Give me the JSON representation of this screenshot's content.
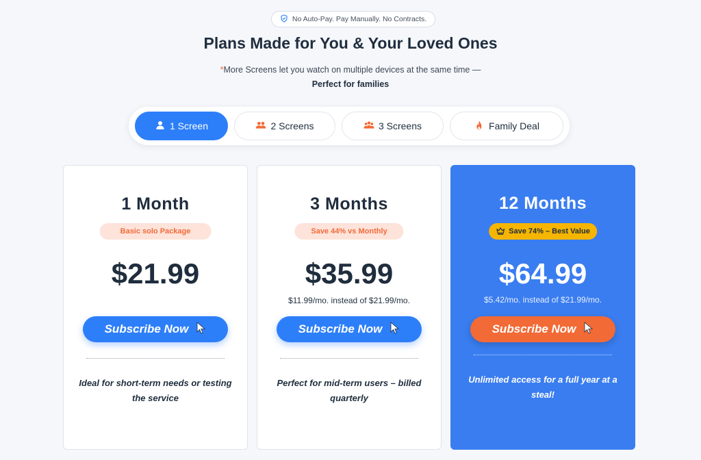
{
  "banner": {
    "text": "No Auto-Pay. Pay Manually. No Contracts.",
    "icon": "shield-check-icon"
  },
  "heading": "Plans Made for You & Your Loved Ones",
  "subtext": {
    "asterisk": "*",
    "line": "More Screens let you watch on multiple devices at the same time — ",
    "bold": "Perfect for families"
  },
  "tabs": [
    {
      "label": "1 Screen",
      "icon": "user-icon",
      "active": true
    },
    {
      "label": "2 Screens",
      "icon": "users-icon",
      "active": false
    },
    {
      "label": "3 Screens",
      "icon": "group-icon",
      "active": false
    },
    {
      "label": "Family Deal",
      "icon": "fire-icon",
      "active": false
    }
  ],
  "plans": [
    {
      "duration": "1 Month",
      "tag": "Basic solo Package",
      "price": "$21.99",
      "per_month": "",
      "cta": "Subscribe Now",
      "description": "Ideal for short-term needs or testing the service",
      "featured": false
    },
    {
      "duration": "3 Months",
      "tag": "Save 44% vs Monthly",
      "price": "$35.99",
      "per_month": "$11.99/mo. instead of $21.99/mo.",
      "cta": "Subscribe Now",
      "description": "Perfect for mid-term users – billed quarterly",
      "featured": false
    },
    {
      "duration": "12 Months",
      "tag": "Save 74% – Best Value",
      "price": "$64.99",
      "per_month": "$5.42/mo. instead of $21.99/mo.",
      "cta": "Subscribe Now",
      "description": "Unlimited access for a full year at a steal!",
      "featured": true
    }
  ],
  "colors": {
    "primary": "#2d7ff9",
    "accent": "#f26a36",
    "featured_card": "#3a7df0",
    "gold": "#f6b500",
    "tag_bg": "#fde3da"
  }
}
